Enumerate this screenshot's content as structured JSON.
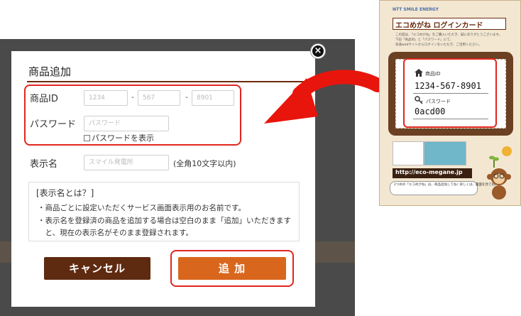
{
  "modal": {
    "title": "商品追加",
    "close_glyph": "×",
    "product_id": {
      "label": "商品ID",
      "fields": [
        {
          "placeholder": "1234"
        },
        {
          "placeholder": "567"
        },
        {
          "placeholder": "8901"
        }
      ],
      "separator": "-"
    },
    "password": {
      "label": "パスワード",
      "placeholder": "パスワード",
      "show_label": "パスワードを表示"
    },
    "display_name": {
      "label": "表示名",
      "placeholder": "スマイル発電所",
      "hint": "(全角10文字以内)"
    },
    "info": {
      "title": "[表示名とは？]",
      "lines": [
        "・商品ごとに設定いただくサービス画面表示用のお名前です。",
        "・表示名を登録済の商品を追加する場合は空白のまま「追加」いただきます",
        "　と、現在の表示名がそのまま登録されます。"
      ]
    },
    "cancel_label": "キャンセル",
    "add_label": "追 加"
  },
  "card": {
    "brand": "NTT SMILE ENERGY",
    "title": "エコめがね ログインカード",
    "notes": [
      "この度は、「エコめがね」をご購入いただき、誠にありがとうございます。",
      "下記「商品ID」と「パスワード」にて、",
      "早速webサイトからログインをいただき、ご活用ください。"
    ],
    "product_id_label": "商品ID",
    "product_id_value": "1234-567-8901",
    "password_label": "パスワード",
    "password_value": "0acd00",
    "url": "http://eco-megane.jp",
    "speech": "2つめの「エコめがね」は、商品追加してね♪ 詳しくは、裏面を見てね♪"
  },
  "colors": {
    "brown_dark": "#5e2a10",
    "orange": "#d9661d",
    "highlight_red": "#e0261e",
    "arrow_red": "#e8150c"
  }
}
